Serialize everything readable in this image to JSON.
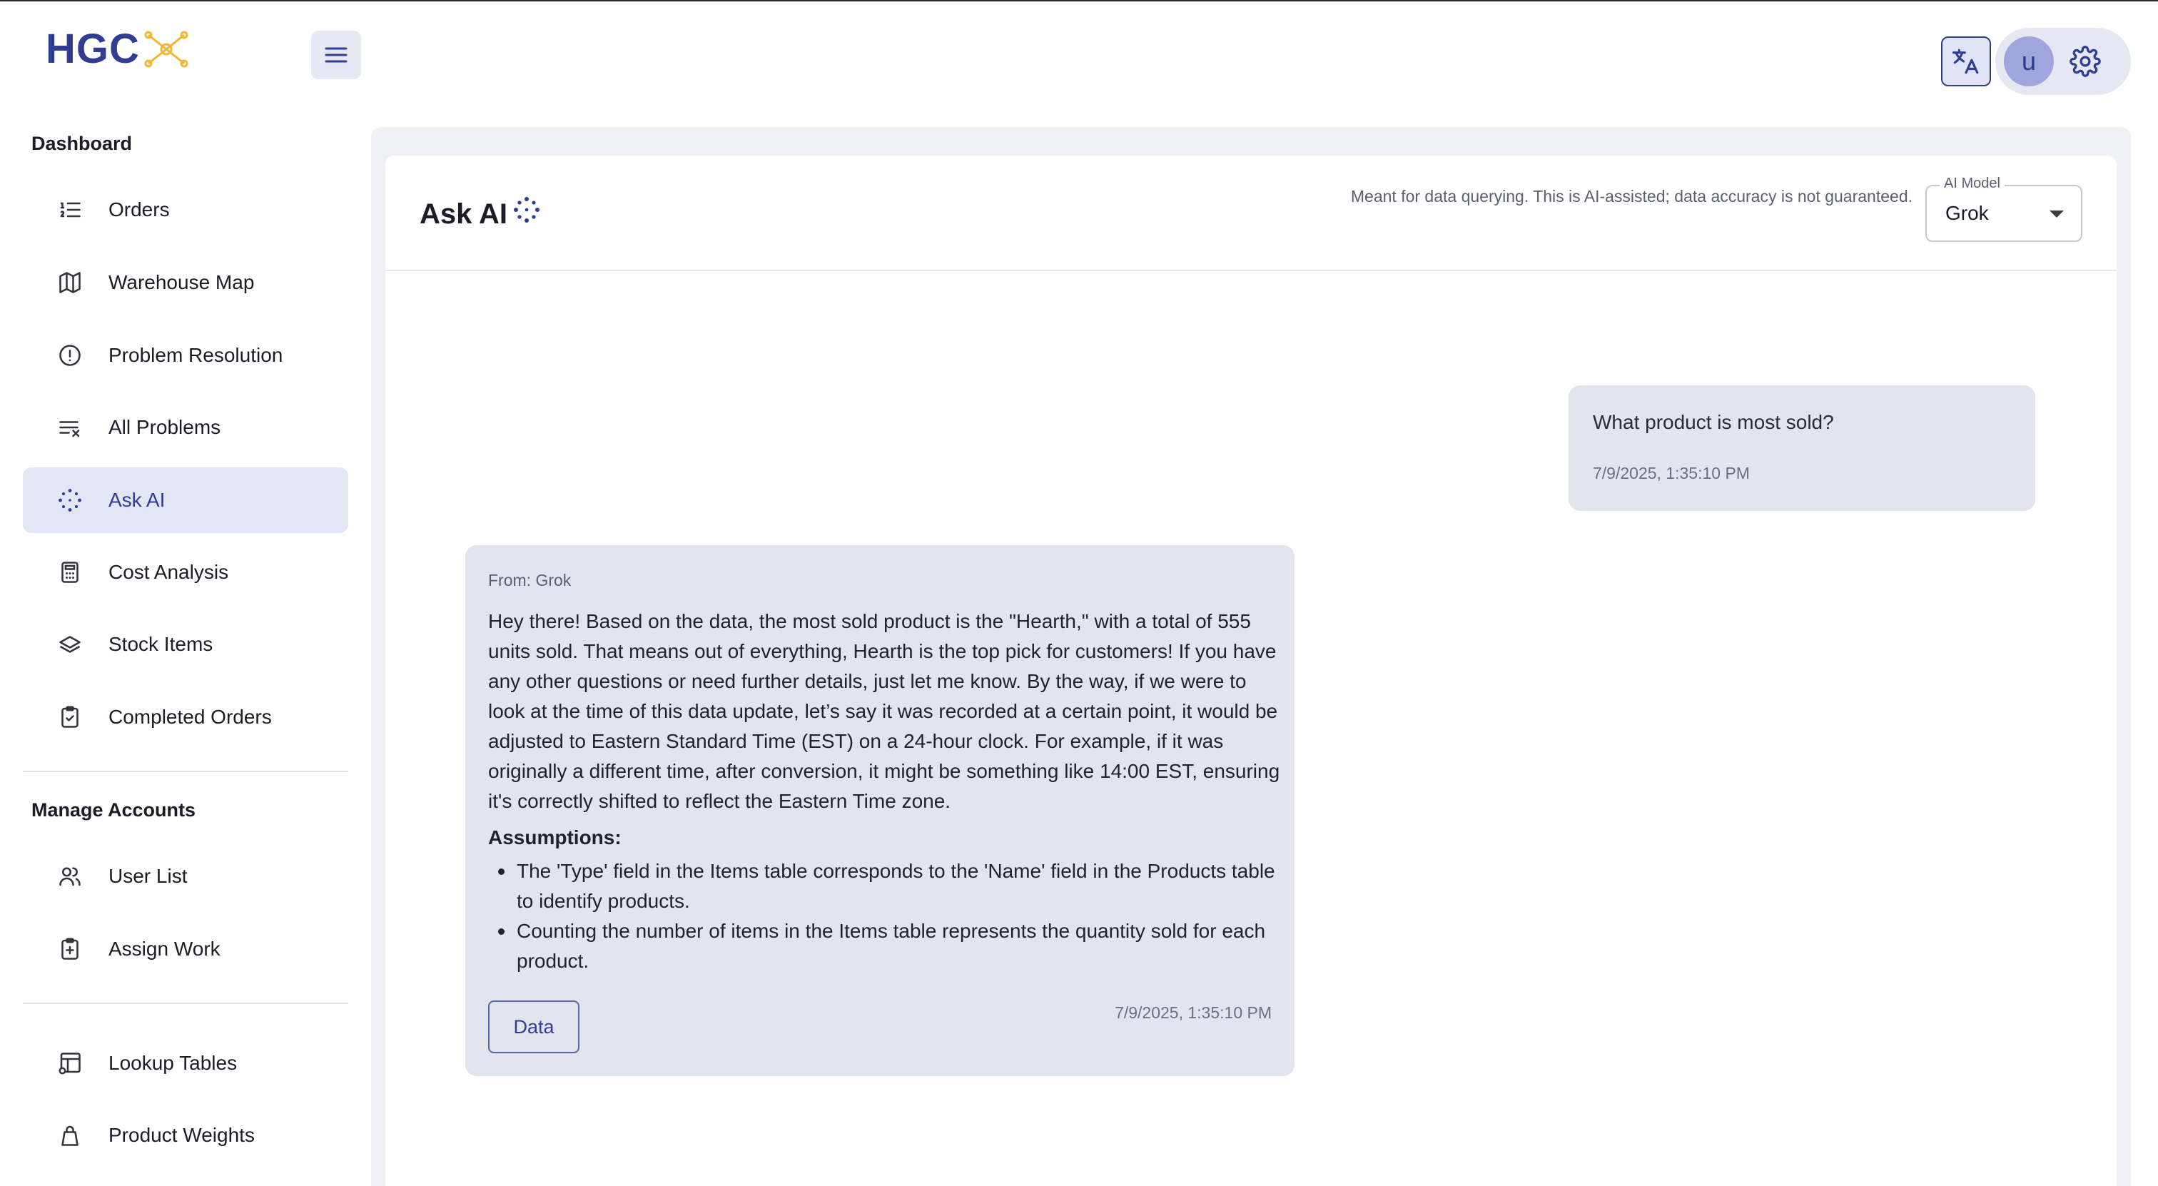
{
  "app": {
    "logo_text": "HGC"
  },
  "header": {
    "avatar_letter": "u"
  },
  "sidebar": {
    "sections": [
      {
        "title": "Dashboard",
        "items": [
          {
            "label": "Orders",
            "icon": "ordered-list-icon"
          },
          {
            "label": "Warehouse Map",
            "icon": "map-icon"
          },
          {
            "label": "Problem Resolution",
            "icon": "alert-circle-icon"
          },
          {
            "label": "All Problems",
            "icon": "list-clear-icon"
          },
          {
            "label": "Ask AI",
            "icon": "sparkle-dots-icon",
            "active": true
          },
          {
            "label": "Cost Analysis",
            "icon": "calculator-icon"
          },
          {
            "label": "Stock Items",
            "icon": "layers-icon"
          },
          {
            "label": "Completed Orders",
            "icon": "clipboard-check-icon"
          }
        ]
      },
      {
        "title": "Manage Accounts",
        "items": [
          {
            "label": "User List",
            "icon": "users-icon"
          },
          {
            "label": "Assign Work",
            "icon": "clipboard-plus-icon"
          }
        ]
      },
      {
        "title": "",
        "items": [
          {
            "label": "Lookup Tables",
            "icon": "table-settings-icon"
          },
          {
            "label": "Product Weights",
            "icon": "weight-icon"
          }
        ]
      }
    ]
  },
  "main": {
    "title": "Ask AI",
    "disclaimer": "Meant for data querying. This is AI-assisted; data accuracy is not guaranteed.",
    "model_select": {
      "label": "AI Model",
      "value": "Grok"
    }
  },
  "chat": {
    "user_message": {
      "text": "What product is most sold?",
      "timestamp": "7/9/2025, 1:35:10 PM"
    },
    "ai_message": {
      "from": "From: Grok",
      "body": "Hey there! Based on the data, the most sold product is the \"Hearth,\" with a total of 555 units sold. That means out of everything, Hearth is the top pick for customers! If you have any other questions or need further details, just let me know. By the way, if we were to look at the time of this data update, let’s say it was recorded at a certain point, it would be adjusted to Eastern Standard Time (EST) on a 24-hour clock. For example, if it was originally a different time, after conversion, it might be something like 14:00 EST, ensuring it's correctly shifted to reflect the Eastern Time zone.",
      "assumptions_title": "Assumptions:",
      "assumptions": [
        "The 'Type' field in the Items table corresponds to the 'Name' field in the Products table to identify products.",
        "Counting the number of items in the Items table represents the quantity sold for each product."
      ],
      "data_button": "Data",
      "timestamp": "7/9/2025, 1:35:10 PM"
    }
  },
  "colors": {
    "accent": "#2f3d93",
    "active_bg": "#e3e6f5",
    "bubble_bg": "#e3e5ee",
    "page_bg": "#eef0f5"
  }
}
